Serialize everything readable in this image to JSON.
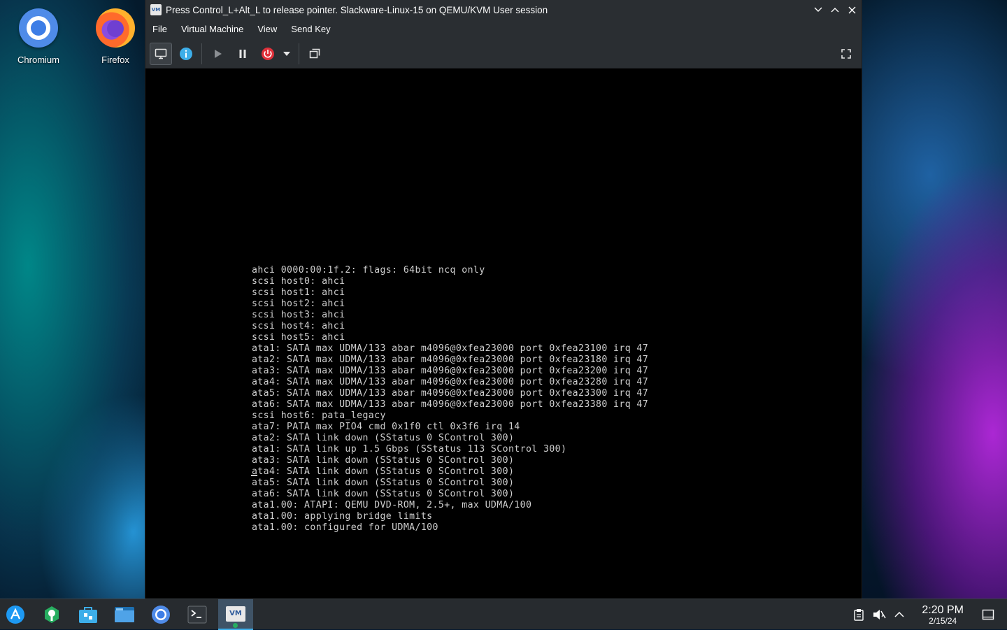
{
  "desktop": {
    "icons": [
      {
        "label": "Chromium",
        "icon": "chromium-icon"
      },
      {
        "label": "Firefox",
        "icon": "firefox-icon"
      }
    ]
  },
  "window": {
    "app_icon_text": "VM",
    "title": "Press Control_L+Alt_L to release pointer. Slackware-Linux-15 on QEMU/KVM User session",
    "controls": [
      "minimize-icon",
      "maximize-icon",
      "close-icon"
    ],
    "menu": [
      "File",
      "Virtual Machine",
      "View",
      "Send Key"
    ],
    "toolbar": [
      "console-icon",
      "info-icon",
      "run-icon",
      "pause-icon",
      "power-icon",
      "dropdown-arrow-icon",
      "snapshot-icon",
      "fullscreen-icon"
    ],
    "colors": {
      "info": "#3daee9",
      "power": "#e0303a"
    }
  },
  "console": {
    "lines": [
      "ahci 0000:00:1f.2: flags: 64bit ncq only",
      "scsi host0: ahci",
      "scsi host1: ahci",
      "scsi host2: ahci",
      "scsi host3: ahci",
      "scsi host4: ahci",
      "scsi host5: ahci",
      "ata1: SATA max UDMA/133 abar m4096@0xfea23000 port 0xfea23100 irq 47",
      "ata2: SATA max UDMA/133 abar m4096@0xfea23000 port 0xfea23180 irq 47",
      "ata3: SATA max UDMA/133 abar m4096@0xfea23000 port 0xfea23200 irq 47",
      "ata4: SATA max UDMA/133 abar m4096@0xfea23000 port 0xfea23280 irq 47",
      "ata5: SATA max UDMA/133 abar m4096@0xfea23000 port 0xfea23300 irq 47",
      "ata6: SATA max UDMA/133 abar m4096@0xfea23000 port 0xfea23380 irq 47",
      "scsi host6: pata_legacy",
      "ata7: PATA max PIO4 cmd 0x1f0 ctl 0x3f6 irq 14",
      "ata2: SATA link down (SStatus 0 SControl 300)",
      "ata1: SATA link up 1.5 Gbps (SStatus 113 SControl 300)",
      "ata3: SATA link down (SStatus 0 SControl 300)",
      "ata4: SATA link down (SStatus 0 SControl 300)",
      "ata5: SATA link down (SStatus 0 SControl 300)",
      "ata6: SATA link down (SStatus 0 SControl 300)",
      "ata1.00: ATAPI: QEMU DVD-ROM, 2.5+, max UDMA/100",
      "ata1.00: applying bridge limits",
      "ata1.00: configured for UDMA/100"
    ]
  },
  "taskbar": {
    "items": [
      "app-launcher-icon",
      "discover-settings-icon",
      "store-icon",
      "file-manager-icon",
      "chromium-icon",
      "terminal-icon",
      "virt-manager-icon"
    ],
    "active_app_text": "VM",
    "tray": [
      "clipboard-icon",
      "volume-muted-icon",
      "tray-expand-icon"
    ],
    "time": "2:20 PM",
    "date": "2/15/24",
    "show_desktop": "show-desktop-icon"
  }
}
